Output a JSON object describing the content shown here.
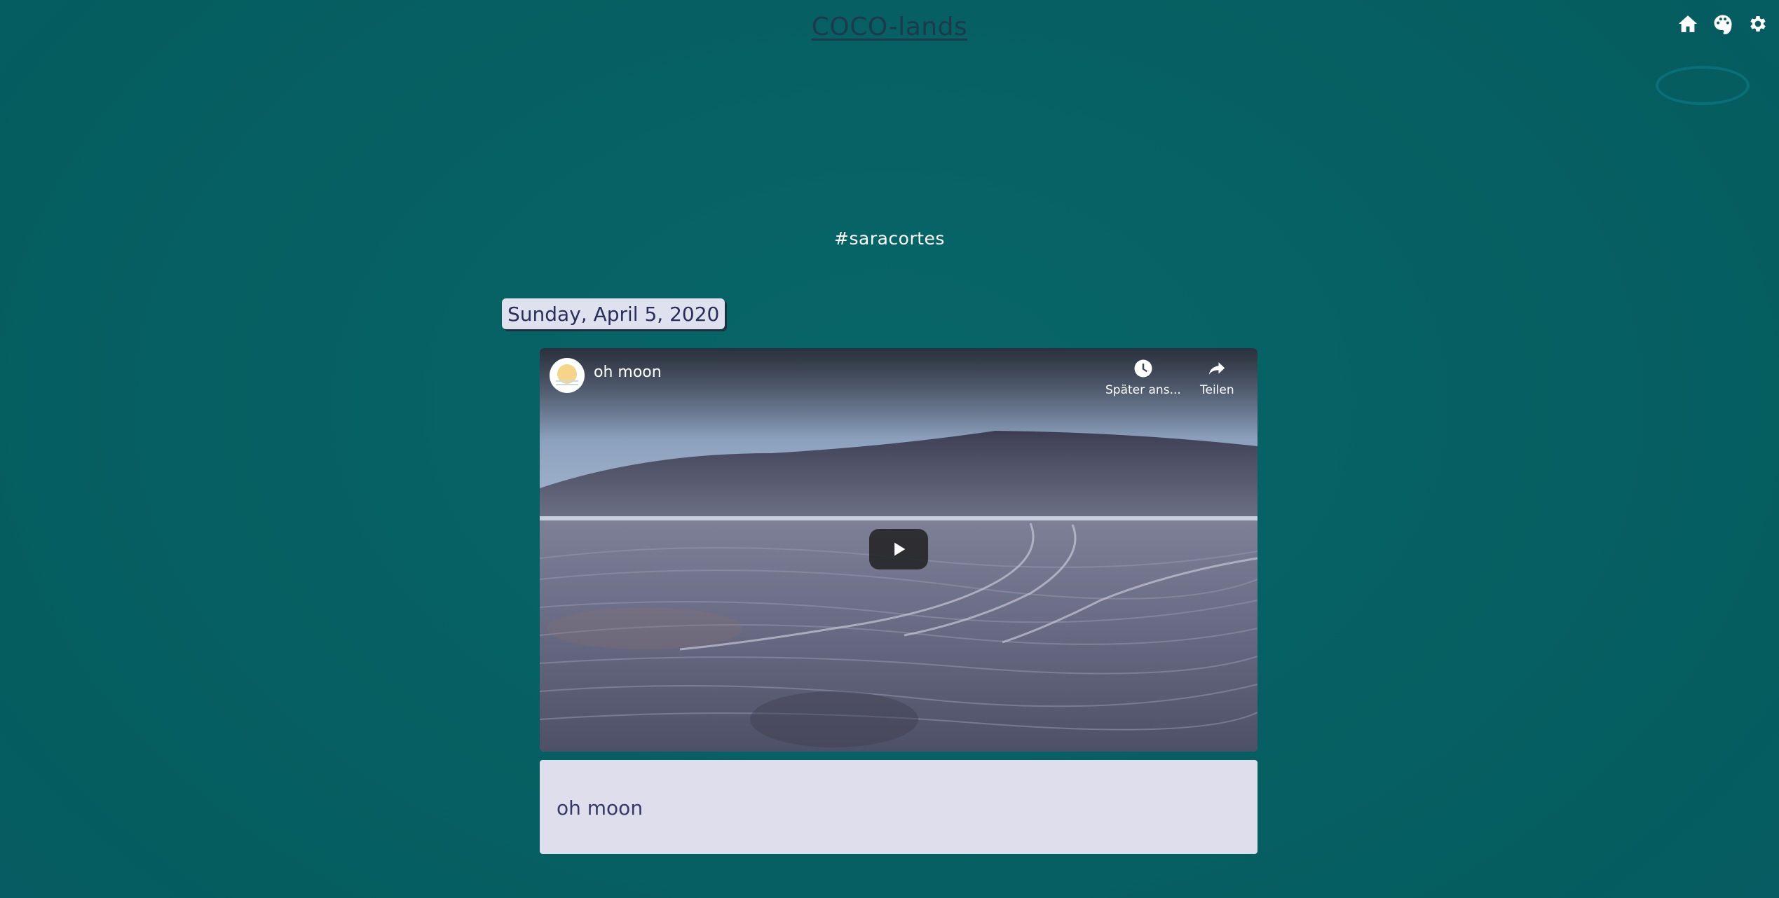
{
  "header": {
    "site_title": "COCO-lands",
    "icons": [
      "home-icon",
      "palette-icon",
      "gear-icon"
    ]
  },
  "tag": {
    "heading": "#saracortes"
  },
  "post": {
    "date": "Sunday, April 5, 2020",
    "video": {
      "title": "oh moon",
      "watch_later_label": "Später ans...",
      "share_label": "Teilen",
      "play_icon": "play-icon"
    },
    "caption": "oh moon"
  },
  "colors": {
    "background": "#066063",
    "title": "#1d3a4a",
    "date_badge_bg": "#dfe1ee",
    "caption_bg": "#dedeed",
    "caption_text": "#343a63"
  }
}
